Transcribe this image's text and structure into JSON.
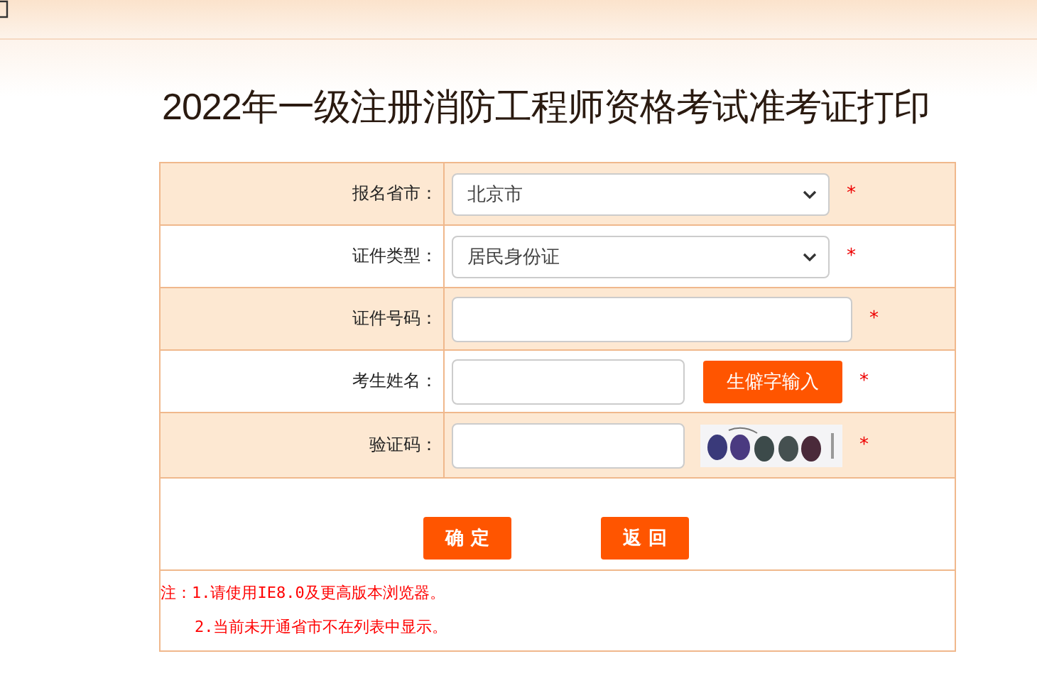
{
  "title": "2022年一级注册消防工程师资格考试准考证打印",
  "rows": [
    {
      "kind": "select",
      "label": "报名省市：",
      "value": "北京市",
      "required_mark": "*"
    },
    {
      "kind": "select",
      "label": "证件类型：",
      "value": "居民身份证",
      "required_mark": "*"
    },
    {
      "kind": "input",
      "label": "证件号码：",
      "required_mark": "*"
    },
    {
      "kind": "input_button",
      "label": "考生姓名：",
      "button": "生僻字输入",
      "required_mark": "*"
    },
    {
      "kind": "captcha",
      "label": "验证码：",
      "required_mark": "*"
    }
  ],
  "buttons": [
    "确 定",
    "返 回"
  ],
  "notes": [
    "注：1.请使用IE8.0及更高版本浏览器。",
    "2.当前未开通省市不在列表中显示。"
  ]
}
